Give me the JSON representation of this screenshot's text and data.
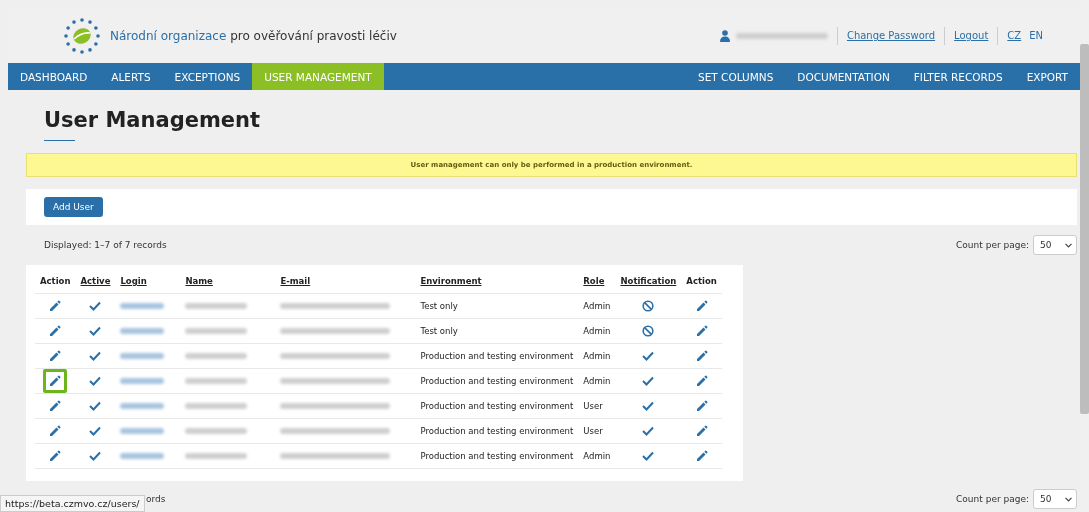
{
  "header": {
    "org_name_highlight": "Národní organizace",
    "org_name_rest": "pro ověřování pravosti léčiv",
    "links": [
      {
        "label": "Change Password"
      },
      {
        "label": "Logout"
      }
    ],
    "languages": [
      {
        "label": "CZ",
        "selected": false
      },
      {
        "label": "EN",
        "selected": true
      }
    ]
  },
  "nav": {
    "left": [
      {
        "label": "DASHBOARD",
        "selected": false
      },
      {
        "label": "ALERTS",
        "selected": false
      },
      {
        "label": "EXCEPTIONS",
        "selected": false
      },
      {
        "label": "USER MANAGEMENT",
        "selected": true
      }
    ],
    "right": [
      {
        "label": "SET COLUMNS"
      },
      {
        "label": "DOCUMENTATION"
      },
      {
        "label": "FILTER RECORDS"
      },
      {
        "label": "EXPORT"
      }
    ]
  },
  "page_title": "User Management",
  "banner": "User management can only be performed in a production environment.",
  "add_button": "Add User",
  "displayed": "Displayed: 1–7 of 7 records",
  "count_label": "Count per page:",
  "count_value": "50",
  "table": {
    "columns": [
      {
        "label": "Action",
        "sortable": false
      },
      {
        "label": "Active",
        "sortable": true
      },
      {
        "label": "Login",
        "sortable": true
      },
      {
        "label": "Name",
        "sortable": true
      },
      {
        "label": "E-mail",
        "sortable": true
      },
      {
        "label": "Environment",
        "sortable": true
      },
      {
        "label": "Role",
        "sortable": true
      },
      {
        "label": "Notification",
        "sortable": true
      },
      {
        "label": "Action",
        "sortable": false
      }
    ],
    "rows": [
      {
        "highlighted": false,
        "active": true,
        "environment": "Test only",
        "role": "Admin",
        "notification": false
      },
      {
        "highlighted": false,
        "active": true,
        "environment": "Test only",
        "role": "Admin",
        "notification": false
      },
      {
        "highlighted": false,
        "active": true,
        "environment": "Production and testing environment",
        "role": "Admin",
        "notification": true
      },
      {
        "highlighted": true,
        "active": true,
        "environment": "Production and testing environment",
        "role": "Admin",
        "notification": true
      },
      {
        "highlighted": false,
        "active": true,
        "environment": "Production and testing environment",
        "role": "User",
        "notification": true
      },
      {
        "highlighted": false,
        "active": true,
        "environment": "Production and testing environment",
        "role": "User",
        "notification": true
      },
      {
        "highlighted": false,
        "active": true,
        "environment": "Production and testing environment",
        "role": "Admin",
        "notification": true
      }
    ]
  },
  "footer": {
    "displayed_visible": "ords",
    "count_label": "Count per page:",
    "count_value": "50"
  },
  "status_url": "https://beta.czmvo.cz/users/"
}
